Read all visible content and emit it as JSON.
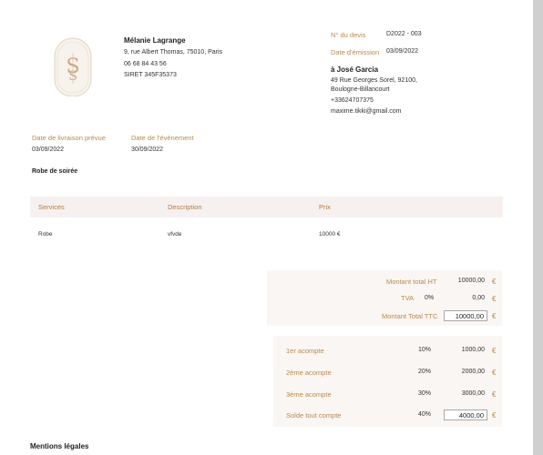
{
  "sender": {
    "name": "Mélanie Lagrange",
    "address": "9, rue Albert Thomas, 75010, Paris",
    "phone": "06 68 84 43 56",
    "siret": "SIRET 345F35373"
  },
  "quote": {
    "number_label": "N° du devis",
    "number_value": "D2022 - 003",
    "date_label": "Date d'émission",
    "date_value": "03/09/2022"
  },
  "client": {
    "name": "à José Garcia",
    "address1": "49 Rue Georges Sorel, 92100,",
    "address2": "Boulogne-Billancourt",
    "phone": "+33624707375",
    "email": "maxime.tikki@gmail.com"
  },
  "dates": {
    "delivery_label": "Date de livraison prévue",
    "delivery_value": "03/09/2022",
    "event_label": "Date de l'évènement",
    "event_value": "30/09/2022"
  },
  "subject": "Robe de soirée",
  "table": {
    "headers": [
      "Services",
      "Description",
      "Prix"
    ],
    "rows": [
      {
        "service": "Robe",
        "description": "vfvde",
        "price": "10000 €"
      }
    ]
  },
  "totals": {
    "ht_label": "Montant total HT",
    "ht_value": "10000,00",
    "tva_label": "TVA",
    "tva_rate": "0%",
    "tva_value": "0,00",
    "ttc_label": "Montant Total TTC",
    "ttc_value": "10000,00",
    "currency": "€"
  },
  "acomptes": [
    {
      "label": "1er acompte",
      "rate": "10%",
      "value": "1000,00"
    },
    {
      "label": "2ème acompte",
      "rate": "20%",
      "value": "2000,00"
    },
    {
      "label": "3ème acompte",
      "rate": "30%",
      "value": "3000,00"
    },
    {
      "label": "Solde tout compte",
      "rate": "40%",
      "value": "4000,00"
    }
  ],
  "legal_title": "Mentions légales",
  "colors": {
    "accent": "#b98a4e",
    "panel": "#faf6f3"
  }
}
